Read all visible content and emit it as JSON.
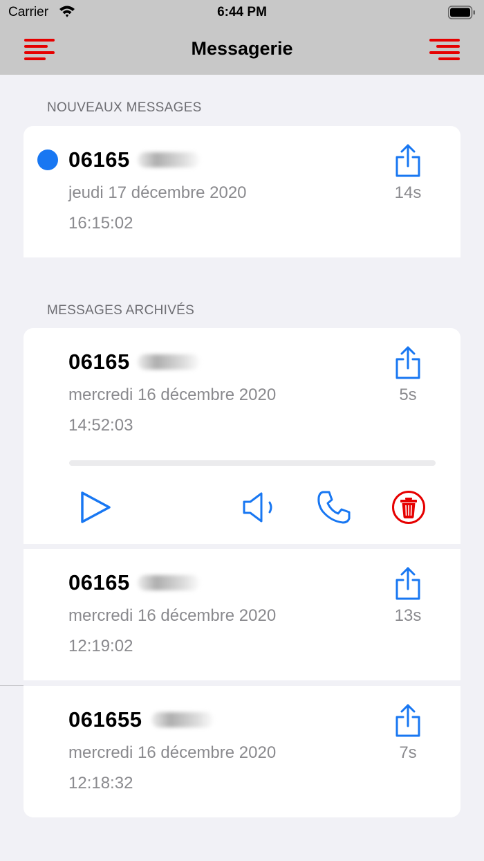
{
  "status": {
    "carrier": "Carrier",
    "time": "6:44 PM"
  },
  "nav": {
    "title": "Messagerie"
  },
  "sections": {
    "new_header": "NOUVEAUX MESSAGES",
    "archived_header": "MESSAGES ARCHIVÉS"
  },
  "new_messages": [
    {
      "number": "06165",
      "date": "jeudi 17 décembre 2020",
      "time": "16:15:02",
      "duration": "14s",
      "unread": true
    }
  ],
  "archived_messages": [
    {
      "number": "06165",
      "date": "mercredi 16 décembre 2020",
      "time": "14:52:03",
      "duration": "5s",
      "expanded": true
    },
    {
      "number": "06165",
      "date": "mercredi 16 décembre 2020",
      "time": "12:19:02",
      "duration": "13s"
    },
    {
      "number": "061655",
      "date": "mercredi 16 décembre 2020",
      "time": "12:18:32",
      "duration": "7s"
    }
  ],
  "player": {
    "progress": 0.0
  },
  "colors": {
    "accent": "#1877f2",
    "danger": "#e60000",
    "menu": "#e60000",
    "nav_bg": "#c8c8c8",
    "bg": "#f1f1f6"
  },
  "icons": {
    "menu_left": "menu-left-aligned-icon",
    "menu_right": "menu-right-aligned-icon",
    "share": "share-icon",
    "play": "play-icon",
    "speaker": "speaker-icon",
    "call": "phone-icon",
    "delete": "trash-icon"
  }
}
